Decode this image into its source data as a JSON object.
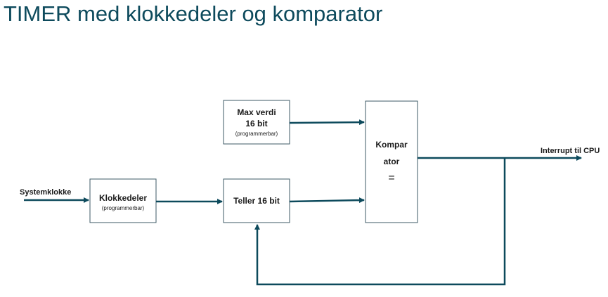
{
  "slide": {
    "title": "TIMER med klokkedeler og komparator"
  },
  "diagram": {
    "input_label": "Systemklokke",
    "output_label": "Interrupt til CPU",
    "blocks": {
      "klokkedeler": {
        "line1": "Klokkedeler",
        "sub": "(programmerbar)"
      },
      "maxverdi": {
        "line1": "Max verdi",
        "line2": "16 bit",
        "sub": "(programmerbar)"
      },
      "teller": {
        "line1": "Teller 16 bit"
      },
      "komparator": {
        "line1": "Kompar",
        "line2": "ator",
        "symbol": "="
      }
    },
    "colors": {
      "wire": "#0d4a5c",
      "box_border": "#3d5a66",
      "title": "#0d4a5c"
    }
  }
}
